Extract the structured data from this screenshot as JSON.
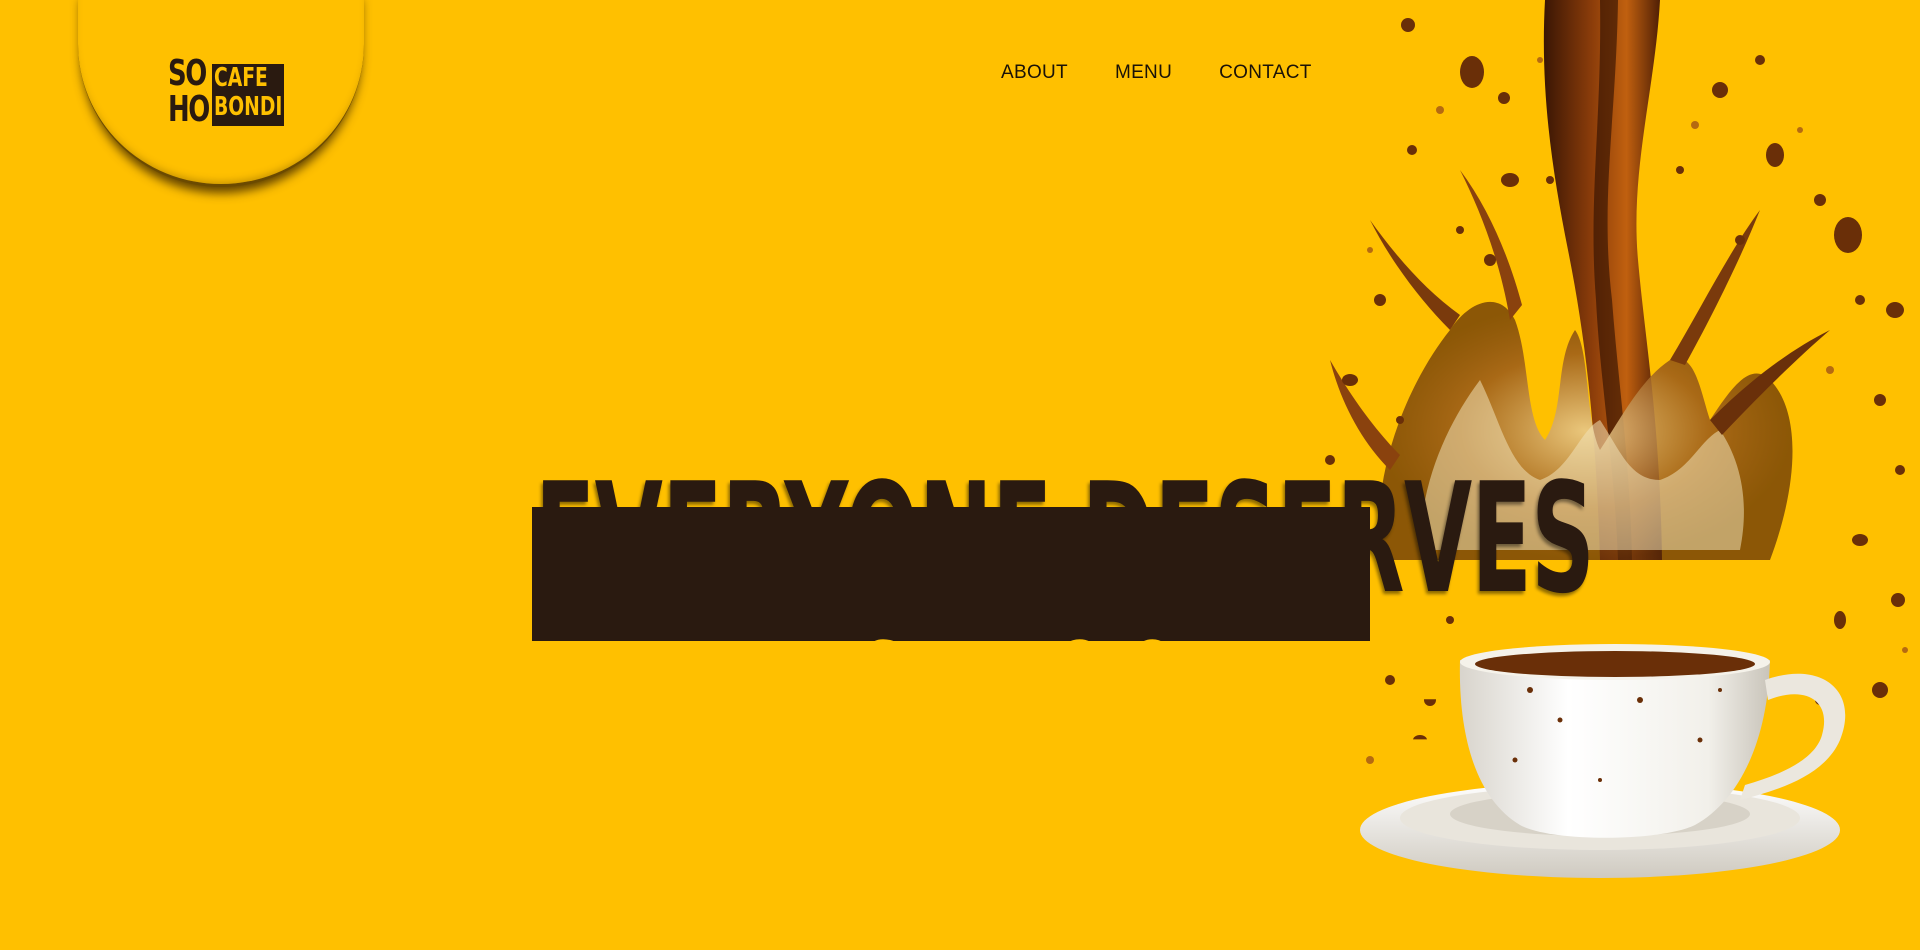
{
  "logo": {
    "soho_line1": "SO",
    "soho_line2": "HO",
    "cafe": "CAFE",
    "bondi": "BONDI"
  },
  "nav": {
    "items": [
      {
        "label": "ABOUT"
      },
      {
        "label": "MENU"
      },
      {
        "label": "CONTACT"
      }
    ]
  },
  "hero": {
    "line1": "EVERYONE DESERVES",
    "line2": "A FRESH COFFEE",
    "image": "coffee-splash-cup-image"
  },
  "colors": {
    "background": "#FFC000",
    "dark": "#2A1A10",
    "coffee": "#7A3A0C"
  }
}
